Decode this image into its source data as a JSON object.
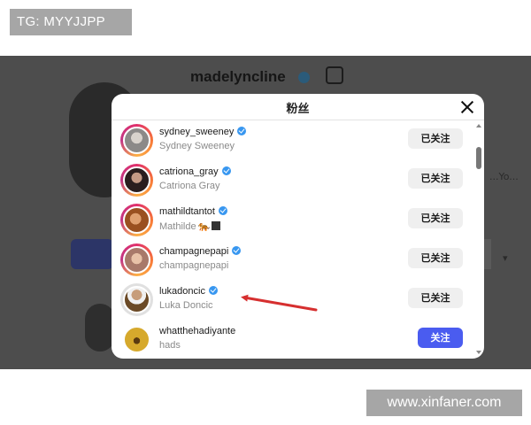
{
  "watermarks": {
    "top_left": "TG: MYYJJPP",
    "bottom_right": "www.xinfaner.com"
  },
  "background_profile": {
    "username": "madelyncline",
    "side_text": "...Yo...",
    "badge_icon": "verified-badge-icon",
    "threads_icon": "threads-icon"
  },
  "modal": {
    "title": "粉丝",
    "close_icon": "close-icon",
    "followers": [
      {
        "username": "sydney_sweeney",
        "full_name": "Sydney Sweeney",
        "verified": true,
        "button": "已关注",
        "state": "following",
        "avatar_color": "#9a9a9a"
      },
      {
        "username": "catriona_gray",
        "full_name": "Catriona Gray",
        "verified": true,
        "button": "已关注",
        "state": "following",
        "avatar_color": "#3a2a2a"
      },
      {
        "username": "mathildtantot",
        "full_name": "Mathilde",
        "full_name_extra": "🐅",
        "verified": true,
        "button": "已关注",
        "state": "following",
        "avatar_color": "#b5702e"
      },
      {
        "username": "champagnepapi",
        "full_name": "champagnepapi",
        "verified": true,
        "button": "已关注",
        "state": "following",
        "avatar_color": "#c7a08a"
      },
      {
        "username": "lukadoncic",
        "full_name": "Luka Doncic",
        "verified": true,
        "button": "已关注",
        "state": "following",
        "avatar_color": "#6b5a3e"
      },
      {
        "username": "whatthehadiyante",
        "full_name": "hads",
        "verified": false,
        "button": "关注",
        "state": "follow",
        "avatar_color": "#c9a02b"
      }
    ]
  },
  "annotation": {
    "color": "#d62f2f",
    "target": "lukadoncic"
  },
  "colors": {
    "follow_button": "#4a5cf0",
    "following_button": "#efefef",
    "verified": "#3897f0",
    "overlay": "#4d4d4d"
  }
}
